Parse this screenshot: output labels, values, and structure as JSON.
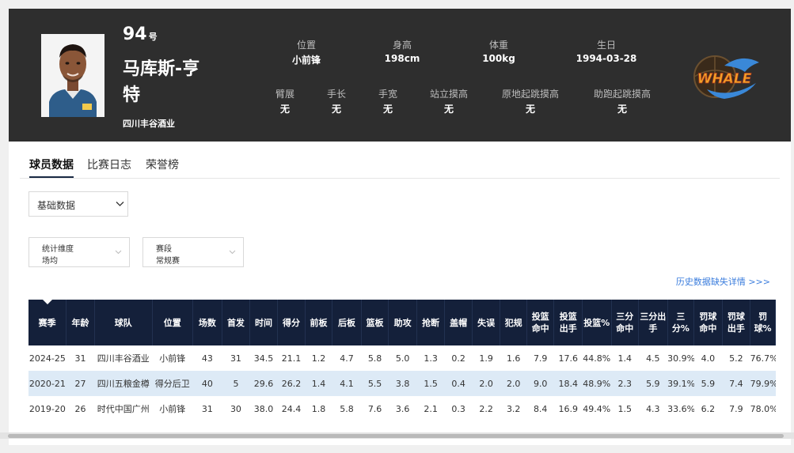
{
  "player": {
    "number": "94",
    "number_suffix": "号",
    "name": "马库斯-亨特",
    "team": "四川丰谷酒业"
  },
  "stats_top": [
    {
      "label": "位置",
      "value": "小前锋"
    },
    {
      "label": "身高",
      "value": "198cm"
    },
    {
      "label": "体重",
      "value": "100kg"
    },
    {
      "label": "生日",
      "value": "1994-03-28"
    }
  ],
  "stats_bottom": [
    {
      "label": "臂展",
      "value": "无"
    },
    {
      "label": "手长",
      "value": "无"
    },
    {
      "label": "手宽",
      "value": "无"
    },
    {
      "label": "站立摸高",
      "value": "无"
    },
    {
      "label": "原地起跳摸高",
      "value": "无"
    },
    {
      "label": "助跑起跳摸高",
      "value": "无"
    }
  ],
  "team_logo_text": "WHALE",
  "tabs": [
    {
      "label": "球员数据",
      "active": true
    },
    {
      "label": "比赛日志",
      "active": false
    },
    {
      "label": "荣誉榜",
      "active": false
    }
  ],
  "filters": {
    "main_select": "基础数据",
    "dimension_label": "统计维度",
    "dimension_value": "场均",
    "stage_label": "赛段",
    "stage_value": "常规赛"
  },
  "history_link": "历史数据缺失详情 >>>",
  "table": {
    "headers": [
      "赛季",
      "年龄",
      "球队",
      "位置",
      "场数",
      "首发",
      "时间",
      "得分",
      "前板",
      "后板",
      "篮板",
      "助攻",
      "抢断",
      "盖帽",
      "失误",
      "犯规",
      "投篮命中",
      "投篮出手",
      "投篮%",
      "三分命中",
      "三分出手",
      "三分%",
      "罚球命中",
      "罚球出手",
      "罚球%"
    ],
    "rows": [
      [
        "2024-25",
        "31",
        "四川丰谷酒业",
        "小前锋",
        "43",
        "31",
        "34.5",
        "21.1",
        "1.2",
        "4.7",
        "5.8",
        "5.0",
        "1.3",
        "0.2",
        "1.9",
        "1.6",
        "7.9",
        "17.6",
        "44.8%",
        "1.4",
        "4.5",
        "30.9%",
        "4.0",
        "5.2",
        "76.7%"
      ],
      [
        "2020-21",
        "27",
        "四川五粮金樽",
        "得分后卫",
        "40",
        "5",
        "29.6",
        "26.2",
        "1.4",
        "4.1",
        "5.5",
        "3.8",
        "1.5",
        "0.4",
        "2.0",
        "2.0",
        "9.0",
        "18.4",
        "48.9%",
        "2.3",
        "5.9",
        "39.1%",
        "5.9",
        "7.4",
        "79.9%"
      ],
      [
        "2019-20",
        "26",
        "时代中国广州",
        "小前锋",
        "31",
        "30",
        "38.0",
        "24.4",
        "1.8",
        "5.8",
        "7.6",
        "3.6",
        "2.1",
        "0.3",
        "2.2",
        "3.2",
        "8.4",
        "16.9",
        "49.4%",
        "1.5",
        "4.3",
        "33.6%",
        "6.2",
        "7.9",
        "78.0%"
      ]
    ]
  },
  "colors": {
    "header_bg": "#2e2e2e",
    "table_header_bg": "#14203a",
    "row_alt_bg": "#ddeaf6",
    "link": "#3b7ddd"
  }
}
